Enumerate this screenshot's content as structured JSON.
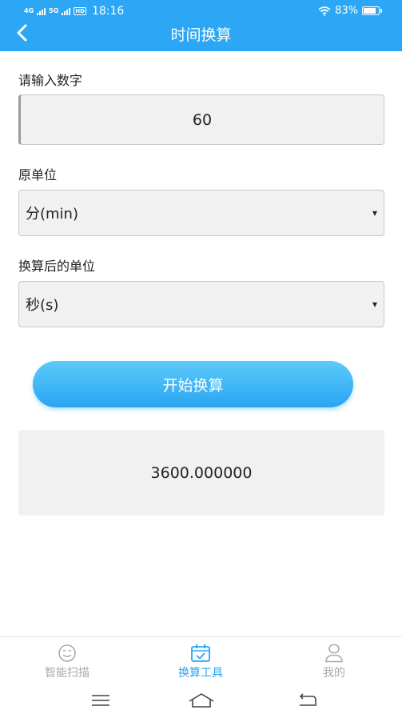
{
  "status_bar": {
    "net1": "4G",
    "net2": "5G",
    "hd": "HD",
    "time": "18:16",
    "battery": "83%",
    "battery_level": 0.83
  },
  "header": {
    "title": "时间换算"
  },
  "form": {
    "number_label": "请输入数字",
    "number_value": "60",
    "from_unit_label": "原单位",
    "from_unit_value": "分(min)",
    "to_unit_label": "换算后的单位",
    "to_unit_value": "秒(s)",
    "caret": "▾",
    "convert_label": "开始换算"
  },
  "result": {
    "value": "3600.000000"
  },
  "tabs": [
    {
      "label": "智能扫描",
      "icon": "smile-scan-icon",
      "active": false
    },
    {
      "label": "换算工具",
      "icon": "calendar-check-icon",
      "active": true
    },
    {
      "label": "我的",
      "icon": "user-icon",
      "active": false
    }
  ],
  "colors": {
    "primary": "#2ba7f5",
    "active_tab": "#2aa5f3",
    "inactive_tab": "#aaaaaa"
  }
}
